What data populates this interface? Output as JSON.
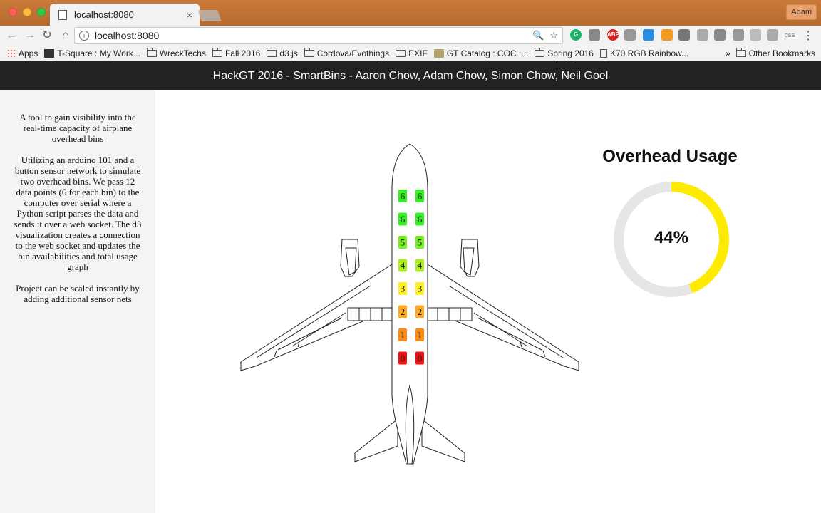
{
  "browser": {
    "tab_title": "localhost:8080",
    "tab_close": "×",
    "profile_name": "Adam",
    "url": "localhost:8080",
    "bookmarks": [
      {
        "label": "Apps",
        "icon": "apps-grid-icon"
      },
      {
        "label": "T-Square : My Work...",
        "icon": "tsquare-icon"
      },
      {
        "label": "WreckTechs",
        "icon": "folder-icon"
      },
      {
        "label": "Fall 2016",
        "icon": "folder-icon"
      },
      {
        "label": "d3.js",
        "icon": "folder-icon"
      },
      {
        "label": "Cordova/Evothings",
        "icon": "folder-icon"
      },
      {
        "label": "EXIF",
        "icon": "folder-icon"
      },
      {
        "label": "GT Catalog : COC :...",
        "icon": "gt-icon"
      },
      {
        "label": "Spring 2016",
        "icon": "folder-icon"
      },
      {
        "label": "K70 RGB Rainbow...",
        "icon": "page-icon"
      }
    ],
    "more_chevron": "»",
    "other_bookmarks": "Other Bookmarks"
  },
  "app": {
    "header": "HackGT 2016 - SmartBins - Aaron Chow, Adam Chow, Simon Chow, Neil Goel",
    "sidebar": {
      "p1": "A tool to gain visibility into the real-time capacity of airplane overhead bins",
      "p2": "Utilizing an arduino 101 and a button sensor network to simulate two overhead bins. We pass 12 data points (6 for each bin) to the computer over serial where a Python script parses the data and sends it over a web socket. The d3 visualization creates a connection to the web socket and updates the bin availabilities and total usage graph",
      "p3": "Project can be scaled instantly by adding additional sensor nets"
    },
    "usage": {
      "title": "Overhead Usage",
      "label": "44%",
      "fraction": 0.44,
      "fill_color": "#ffeb00",
      "track_color": "#e6e6e6"
    },
    "bins": {
      "left": [
        {
          "label": "6",
          "color": "#33ee22"
        },
        {
          "label": "6",
          "color": "#33ee22"
        },
        {
          "label": "5",
          "color": "#77ee22"
        },
        {
          "label": "4",
          "color": "#aaee22"
        },
        {
          "label": "3",
          "color": "#ffee22"
        },
        {
          "label": "2",
          "color": "#ffaa22"
        },
        {
          "label": "1",
          "color": "#ff8811"
        },
        {
          "label": "0",
          "color": "#ee1111"
        }
      ],
      "right": [
        {
          "label": "6",
          "color": "#33ee22"
        },
        {
          "label": "6",
          "color": "#33ee22"
        },
        {
          "label": "5",
          "color": "#77ee22"
        },
        {
          "label": "4",
          "color": "#aaee22"
        },
        {
          "label": "3",
          "color": "#ffee22"
        },
        {
          "label": "2",
          "color": "#ffaa22"
        },
        {
          "label": "1",
          "color": "#ff8811"
        },
        {
          "label": "0",
          "color": "#ee1111"
        }
      ]
    }
  }
}
